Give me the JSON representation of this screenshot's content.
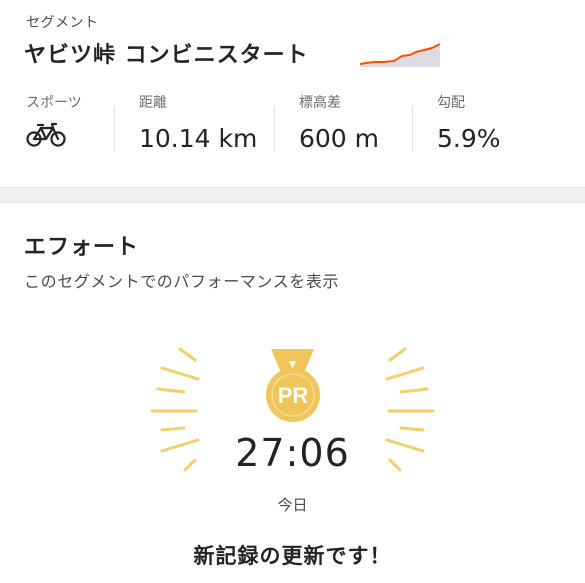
{
  "segment": {
    "kicker": "セグメント",
    "title": "ヤビツ峠 コンビニスタート",
    "elevation_profile_colors": {
      "line": "#fc5200",
      "fill": "#dcdce2"
    }
  },
  "stats": [
    {
      "label": "スポーツ",
      "icon": "bicycle-icon"
    },
    {
      "label": "距離",
      "value": "10.14 km"
    },
    {
      "label": "標高差",
      "value": "600 m"
    },
    {
      "label": "勾配",
      "value": "5.9%"
    }
  ],
  "effort": {
    "title": "エフォート",
    "subtitle": "このセグメントでのパフォーマンスを表示",
    "badge_text": "PR",
    "time": "27:06",
    "date": "今日",
    "message": "新記録の更新です！"
  },
  "colors": {
    "medal_gold": "#f0c65a",
    "ray_gold": "#f2cf6b",
    "text": "#242428",
    "band": "#f0f0f3"
  }
}
